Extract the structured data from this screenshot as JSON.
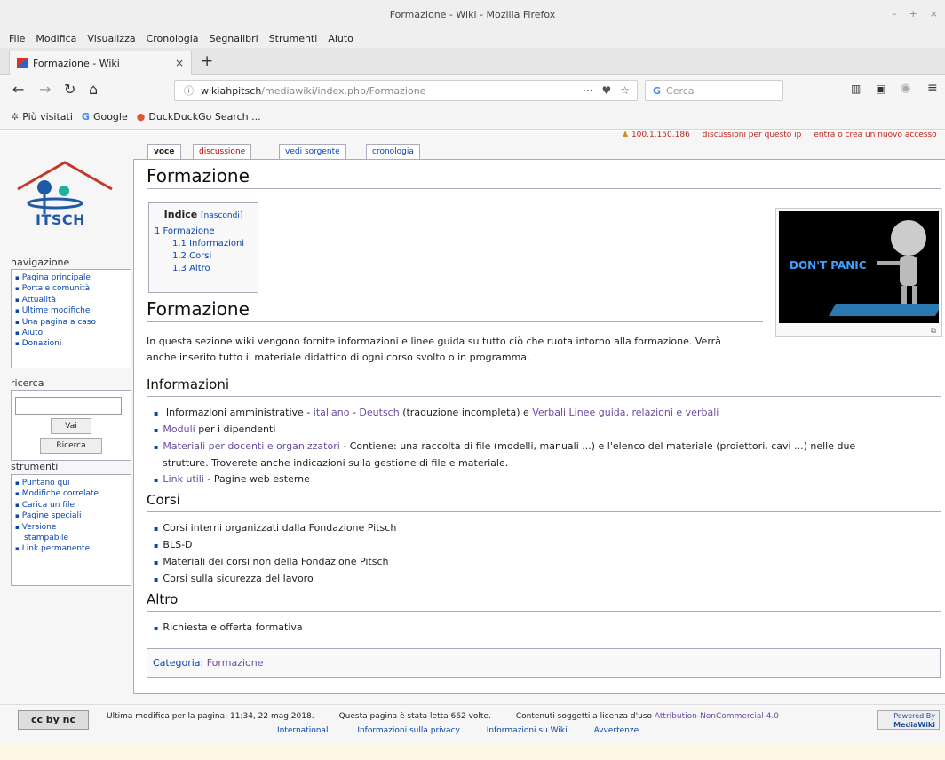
{
  "window": {
    "title": "Formazione - Wiki - Mozilla Firefox",
    "controls": [
      "–",
      "+",
      "×"
    ]
  },
  "menu": [
    "File",
    "Modifica",
    "Visualizza",
    "Cronologia",
    "Segnalibri",
    "Strumenti",
    "Aiuto"
  ],
  "browser_tab": {
    "label": "Formazione - Wiki",
    "close": "×",
    "new_tab": "+"
  },
  "nav": {
    "url_domain": "wikiahpitsch",
    "url_path": "/mediawiki/index.php/Formazione",
    "search_placeholder": "Cerca",
    "more": "···",
    "pocket": "♥",
    "star": "☆"
  },
  "bookmarks": [
    "Più visitati",
    "Google",
    "DuckDuckGo Search ..."
  ],
  "user_links": {
    "ip": "100.1.150.186",
    "talk": "discussioni per questo ip",
    "login": "entra o crea un nuovo accesso"
  },
  "page_tabs": {
    "voce": "voce",
    "discussione": "discussione",
    "sorgente": "vedi sorgente",
    "cronologia": "cronologia"
  },
  "logo": {
    "text": "ITSCH"
  },
  "sidebar": {
    "nav_title": "navigazione",
    "nav_items": [
      "Pagina principale",
      "Portale comunità",
      "Attualità",
      "Ultime modifiche",
      "Una pagina a caso",
      "Aiuto",
      "Donazioni"
    ],
    "search_title": "ricerca",
    "vai": "Vai",
    "ricerca": "Ricerca",
    "tools_title": "strumenti",
    "tools_items": [
      "Puntano qui",
      "Modifiche correlate",
      "Carica un file",
      "Pagine speciali",
      "Versione",
      "stampabile",
      "Link permanente"
    ]
  },
  "content": {
    "title": "Formazione",
    "toc": {
      "title": "Indice",
      "hide": "[nascondi]",
      "items": [
        "1 Formazione",
        "1.1 Informazioni",
        "1.2 Corsi",
        "1.3 Altro"
      ]
    },
    "image_text": "DON'T PANIC",
    "h_formazione": "Formazione",
    "intro_line1": "In questa sezione wiki vengono fornite informazioni e linee guida su tutto ciò che ruota intorno alla formazione. Verrà",
    "intro_line2": "anche inserito tutto il materiale didattico di ogni corso svolto o in programma.",
    "h_informazioni": "Informazioni",
    "info": {
      "l1a": "Informazioni amministrative - ",
      "l1b": "italiano",
      "l1c": " - ",
      "l1d": "Deutsch",
      "l1e": " (traduzione incompleta) e ",
      "l1f": "Verbali Linee guida, relazioni e verbali",
      "l2a": "Moduli",
      "l2b": " per i dipendenti",
      "l3a": "Materiali per docenti e organizzatori",
      "l3b": " - Contiene: una raccolta di file (modelli, manuali ...) e l'elenco del materiale (proiettori, cavi ...) nelle due",
      "l3c": "strutture. Troverete anche indicazioni sulla gestione di file e materiale.",
      "l4a": "Link utili",
      "l4b": " - Pagine web esterne"
    },
    "h_corsi": "Corsi",
    "corsi": [
      "Corsi interni organizzati dalla Fondazione Pitsch",
      "BLS-D",
      "Materiali dei corsi non della Fondazione Pitsch",
      "Corsi sulla sicurezza del lavoro"
    ],
    "h_altro": "Altro",
    "altro": [
      "Richiesta e offerta formativa"
    ],
    "category_label": "Categoria",
    "category_sep": ": ",
    "category": "Formazione"
  },
  "footer": {
    "cc": "cc by nc",
    "modified": "Ultima modifica per la pagina: 11:34, 22 mag 2018.",
    "views": "Questa pagina è stata letta 662 volte.",
    "license_a": "Contenuti soggetti a licenza d'uso",
    "license_b": "Attribution-NonCommercial 4.0",
    "international": "International.",
    "privacy": "Informazioni sulla privacy",
    "about": "Informazioni su Wiki",
    "disclaimer": "Avvertenze",
    "powered_by": "Powered By",
    "mediawiki": "MediaWiki"
  }
}
